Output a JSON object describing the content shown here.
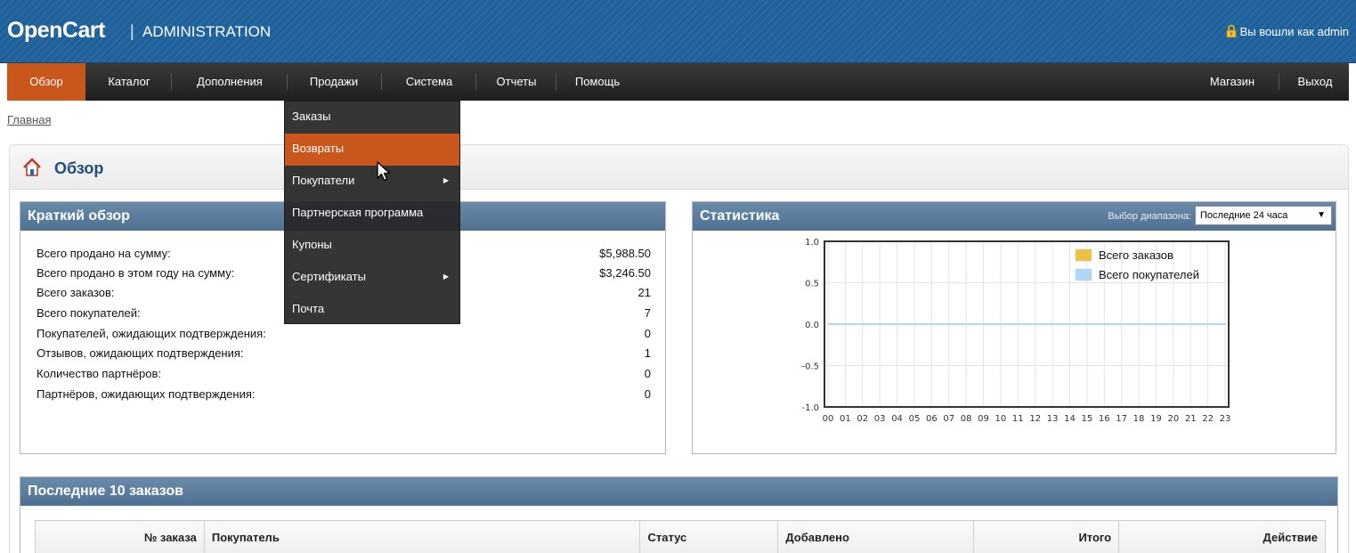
{
  "header": {
    "logo": "OpenCart",
    "separator": "|",
    "subtitle": "ADMINISTRATION",
    "login_text": "Вы вошли как admin"
  },
  "menu": {
    "items": [
      {
        "label": "Обзор",
        "active": true
      },
      {
        "label": "Каталог"
      },
      {
        "label": "Дополнения"
      },
      {
        "label": "Продажи"
      },
      {
        "label": "Система"
      },
      {
        "label": "Отчеты"
      },
      {
        "label": "Помощь"
      }
    ],
    "right_items": [
      {
        "label": "Магазин"
      },
      {
        "label": "Выход"
      }
    ]
  },
  "dropdown": {
    "items": [
      {
        "label": "Заказы"
      },
      {
        "label": "Возвраты",
        "hover": true
      },
      {
        "label": "Покупатели",
        "submenu": true
      },
      {
        "label": "Партнерская программа"
      },
      {
        "label": "Купоны"
      },
      {
        "label": "Сертификаты",
        "submenu": true
      },
      {
        "label": "Почта"
      }
    ]
  },
  "breadcrumb": {
    "home": "Главная"
  },
  "page": {
    "title": "Обзор"
  },
  "summary": {
    "title": "Краткий обзор",
    "rows": [
      {
        "label": "Всего продано на сумму:",
        "value": "$5,988.50"
      },
      {
        "label": "Всего продано в этом году на сумму:",
        "value": "$3,246.50"
      },
      {
        "label": "Всего заказов:",
        "value": "21"
      },
      {
        "label": "Всего покупателей:",
        "value": "7"
      },
      {
        "label": "Покупателей, ожидающих подтверждения:",
        "value": "0"
      },
      {
        "label": "Отзывов, ожидающих подтверждения:",
        "value": "1"
      },
      {
        "label": "Количество партнёров:",
        "value": "0"
      },
      {
        "label": "Партнёров, ожидающих подтверждения:",
        "value": "0"
      }
    ]
  },
  "stats": {
    "title": "Статистика",
    "range_label": "Выбор диапазона:",
    "range_value": "Последние 24 часа",
    "arrow": "▼"
  },
  "chart_data": {
    "type": "line",
    "x": [
      "00",
      "01",
      "02",
      "03",
      "04",
      "05",
      "06",
      "07",
      "08",
      "09",
      "10",
      "11",
      "12",
      "13",
      "14",
      "15",
      "16",
      "17",
      "18",
      "19",
      "20",
      "21",
      "22",
      "23"
    ],
    "y_ticks": [
      "1.0",
      "0.5",
      "0.0",
      "-0.5",
      "-1.0"
    ],
    "ylim": [
      -1.0,
      1.0
    ],
    "grid": true,
    "legend_position": "top-right",
    "series": [
      {
        "name": "Всего заказов",
        "color": "#edc240",
        "values": [
          0,
          0,
          0,
          0,
          0,
          0,
          0,
          0,
          0,
          0,
          0,
          0,
          0,
          0,
          0,
          0,
          0,
          0,
          0,
          0,
          0,
          0,
          0,
          0
        ]
      },
      {
        "name": "Всего покупателей",
        "color": "#afd8f8",
        "values": [
          0,
          0,
          0,
          0,
          0,
          0,
          0,
          0,
          0,
          0,
          0,
          0,
          0,
          0,
          0,
          0,
          0,
          0,
          0,
          0,
          0,
          0,
          0,
          0
        ]
      }
    ]
  },
  "orders": {
    "title": "Последние 10 заказов",
    "columns": [
      "№ заказа",
      "Покупатель",
      "Статус",
      "Добавлено",
      "Итого",
      "Действие"
    ]
  },
  "colors": {
    "accent": "#c9561a",
    "header_blue": "#1f5f96",
    "panel_head": "#4f7192",
    "title_blue": "#1f4e79"
  },
  "icons": {
    "lock": "lock-icon",
    "home": "home-icon",
    "cursor": "cursor-icon",
    "submenu": "chevron-right-icon"
  }
}
